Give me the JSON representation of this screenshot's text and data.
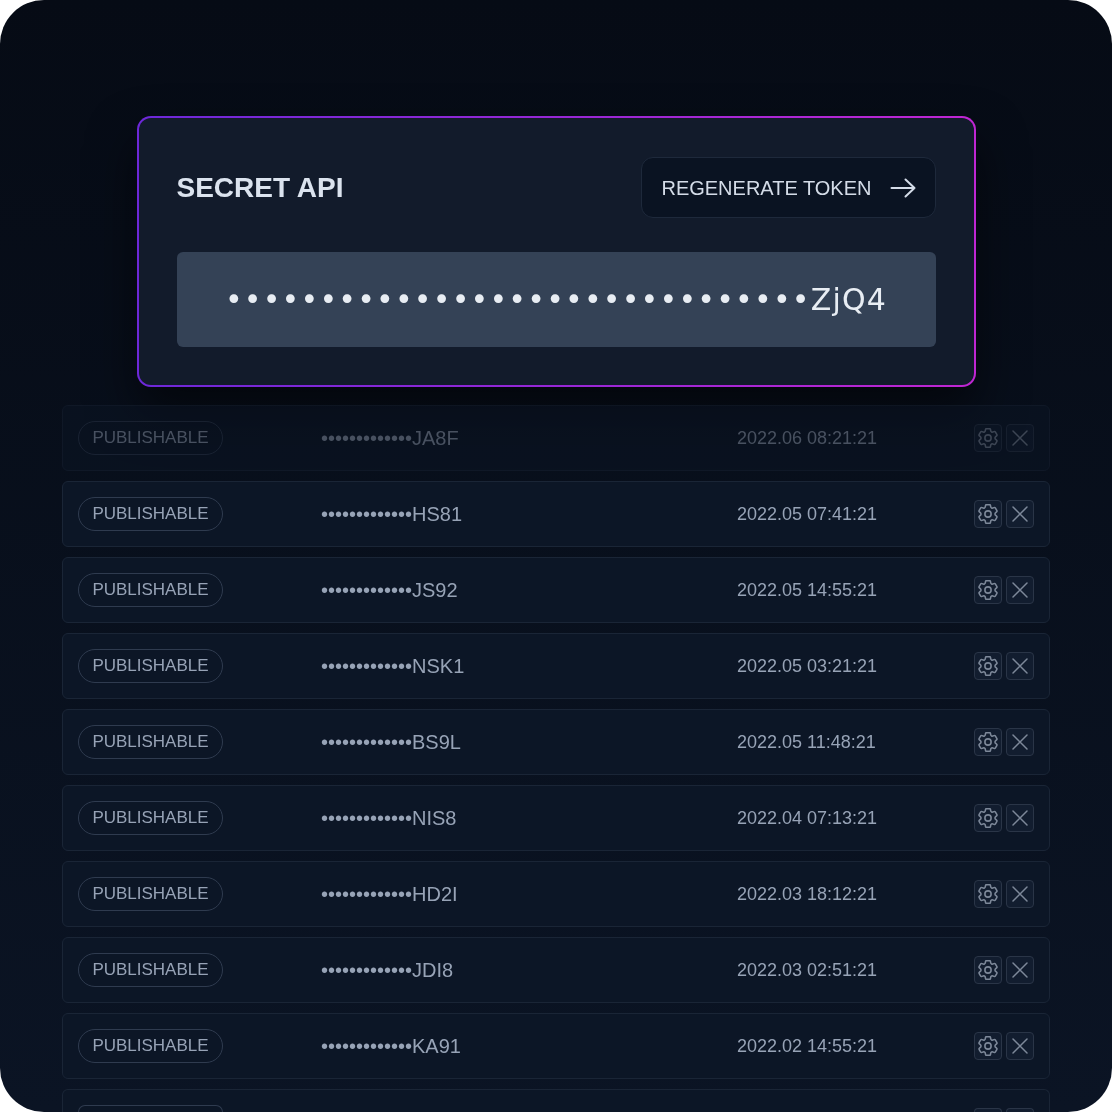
{
  "card": {
    "title": "SECRET API",
    "button": {
      "label": "REGENERATE TOKEN"
    },
    "token": {
      "value": "•••••••••••••••••••••••••••••••ZjQ4"
    }
  },
  "keys": [
    {
      "type": "PUBLISHABLE",
      "key": "•••••••••••••JA8F",
      "date": "2022.06 08:21:21",
      "faded": true
    },
    {
      "type": "PUBLISHABLE",
      "key": "•••••••••••••HS81",
      "date": "2022.05 07:41:21",
      "faded": false
    },
    {
      "type": "PUBLISHABLE",
      "key": "•••••••••••••JS92",
      "date": "2022.05 14:55:21",
      "faded": false
    },
    {
      "type": "PUBLISHABLE",
      "key": "•••••••••••••NSK1",
      "date": "2022.05 03:21:21",
      "faded": false
    },
    {
      "type": "PUBLISHABLE",
      "key": "•••••••••••••BS9L",
      "date": "2022.05 11:48:21",
      "faded": false
    },
    {
      "type": "PUBLISHABLE",
      "key": "•••••••••••••NIS8",
      "date": "2022.04 07:13:21",
      "faded": false
    },
    {
      "type": "PUBLISHABLE",
      "key": "•••••••••••••HD2I",
      "date": "2022.03 18:12:21",
      "faded": false
    },
    {
      "type": "PUBLISHABLE",
      "key": "•••••••••••••JDI8",
      "date": "2022.03 02:51:21",
      "faded": false
    },
    {
      "type": "PUBLISHABLE",
      "key": "•••••••••••••KA91",
      "date": "2022.02 14:55:21",
      "faded": false
    }
  ]
}
